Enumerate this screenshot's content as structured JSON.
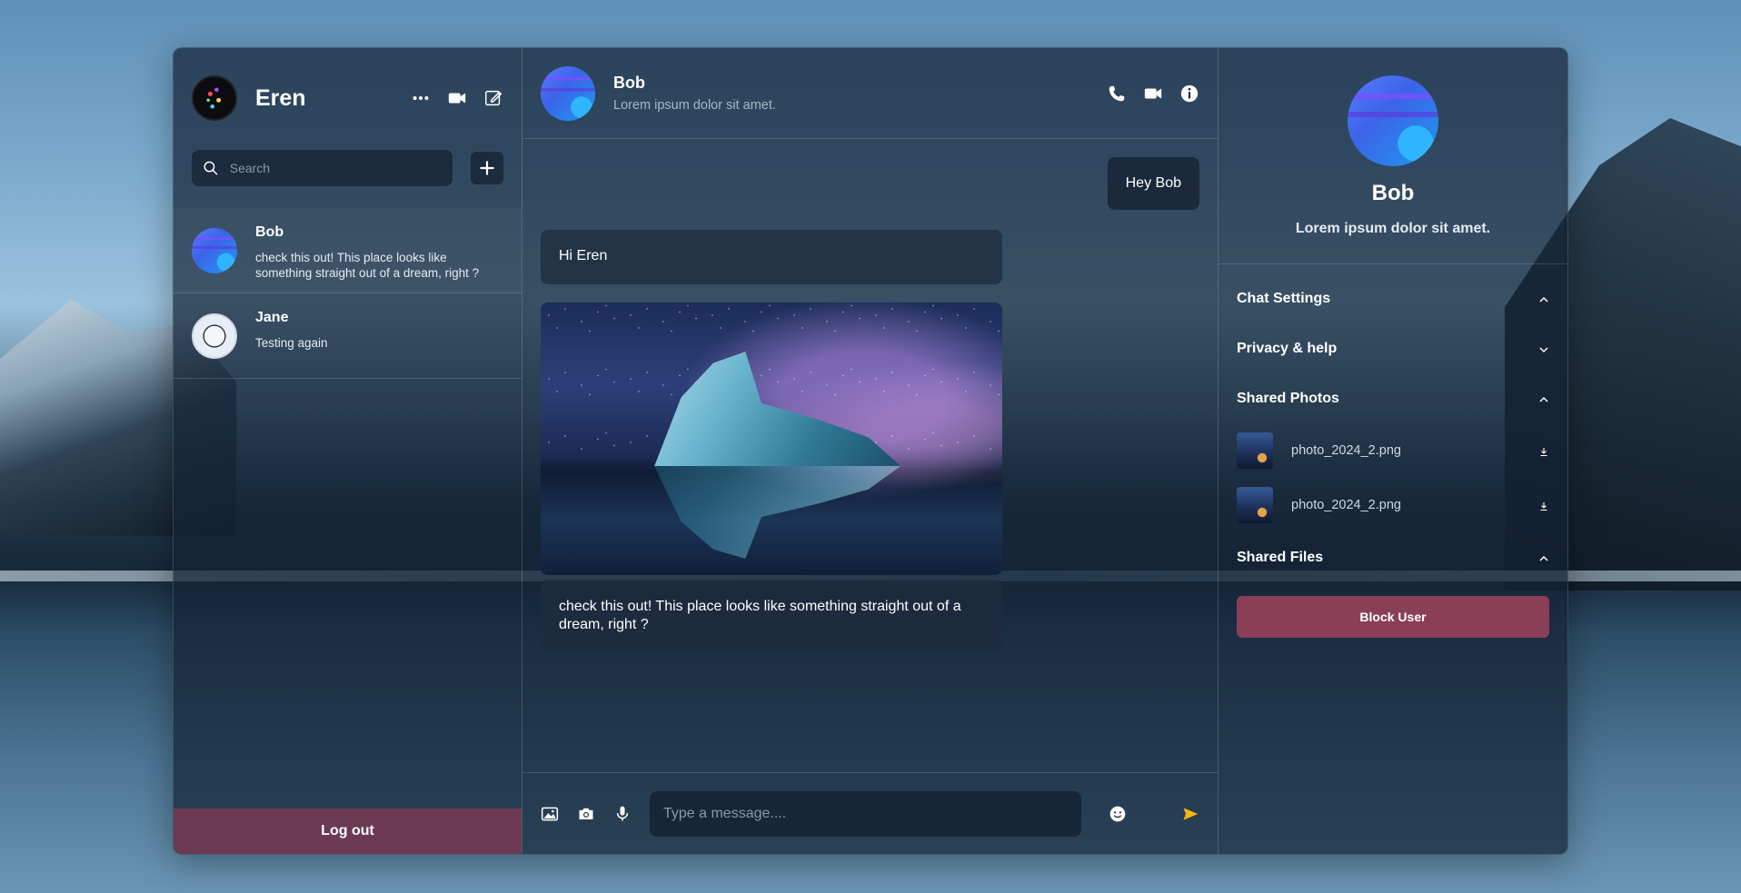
{
  "colors": {
    "accent_send": "#f5b70a",
    "logout_bg": "#6b3a52",
    "block_bg": "#8b3f57"
  },
  "left": {
    "user_name": "Eren",
    "search_placeholder": "Search",
    "logout_label": "Log out",
    "chats": [
      {
        "name": "Bob",
        "last_message": "check this out! This place looks like something straight out of a dream, right ?"
      },
      {
        "name": "Jane",
        "last_message": "Testing again"
      }
    ]
  },
  "center": {
    "contact_name": "Bob",
    "contact_status": "Lorem ipsum dolor sit amet.",
    "messages": {
      "own": "Hey Bob",
      "incoming_1": "Hi Eren",
      "caption": "check this out! This place looks like something straight out of a dream, right ?"
    },
    "input_placeholder": "Type a message...."
  },
  "right": {
    "name": "Bob",
    "status": "Lorem ipsum dolor sit amet.",
    "sections": {
      "chat_settings": "Chat Settings",
      "privacy": "Privacy & help",
      "shared_photos": "Shared Photos",
      "shared_files": "Shared Files"
    },
    "photos": [
      "photo_2024_2.png",
      "photo_2024_2.png"
    ],
    "block_label": "Block User"
  }
}
